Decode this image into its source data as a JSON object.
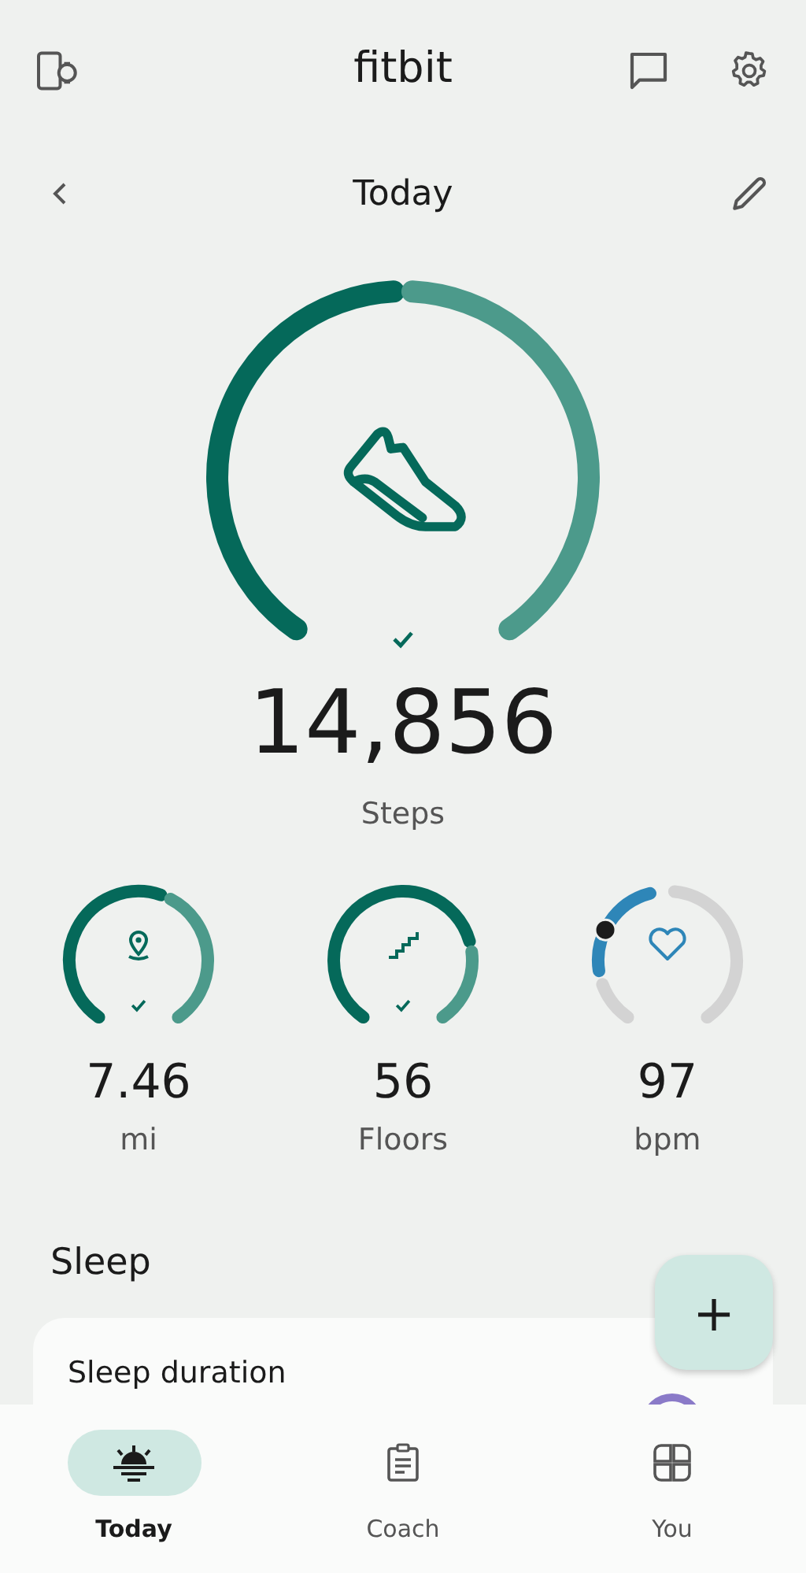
{
  "app_bar": {
    "title": "fitbit"
  },
  "date_bar": {
    "title": "Today"
  },
  "steps": {
    "kind": "activity",
    "goal_met": true,
    "value": "14,856",
    "label": "Steps"
  },
  "stats": [
    {
      "kind": "activity",
      "goal_met": true,
      "value": "7.46",
      "label": "mi"
    },
    {
      "kind": "activity",
      "goal_met": true,
      "value": "56",
      "label": "Floors"
    },
    {
      "kind": "heart",
      "goal_met": false,
      "value": "97",
      "label": "bpm"
    }
  ],
  "sleep": {
    "heading": "Sleep",
    "card_title": "Sleep duration"
  },
  "fab": {
    "label": "+"
  },
  "nav": [
    {
      "label": "Today",
      "selected": true
    },
    {
      "label": "Coach",
      "selected": false
    },
    {
      "label": "You",
      "selected": false
    }
  ]
}
